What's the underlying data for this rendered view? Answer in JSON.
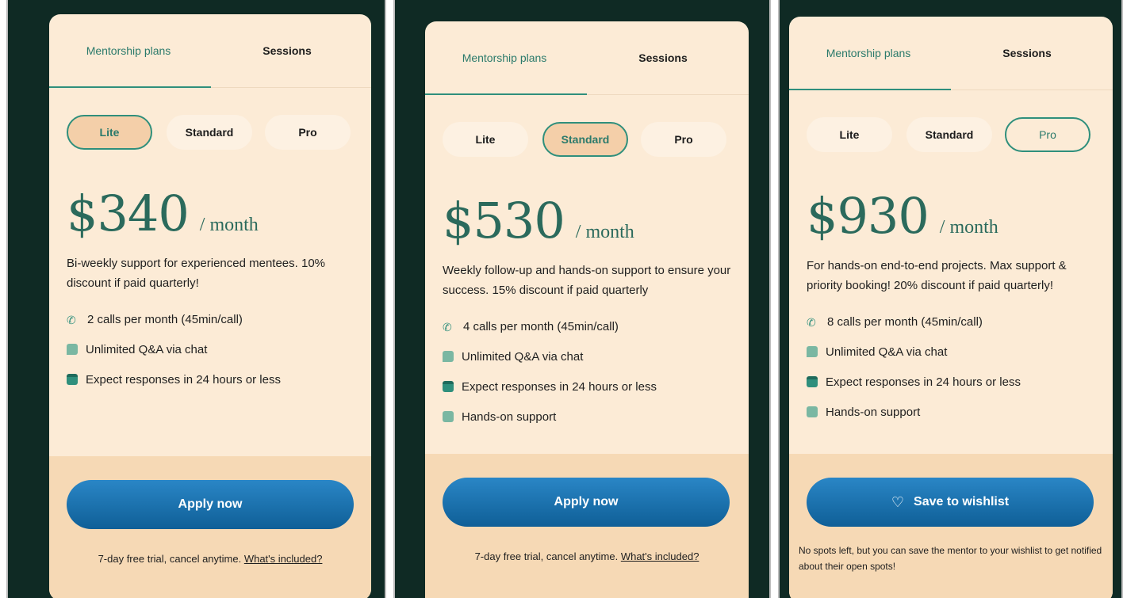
{
  "tabs": {
    "mentorship": "Mentorship plans",
    "sessions": "Sessions"
  },
  "tiers": [
    "Lite",
    "Standard",
    "Pro"
  ],
  "per": "/ month",
  "colors": {
    "accent": "#2f8f7c",
    "card": "#fcebd6",
    "cta": "#1f76b5",
    "bg": "#0f2a24"
  },
  "icons": [
    "phone-icon",
    "chat-icon",
    "calendar-icon",
    "lock-icon",
    "heart-icon"
  ],
  "plans": [
    {
      "selected": "Lite",
      "price": "$340",
      "description": "Bi-weekly support for experienced mentees. 10% discount if paid quarterly!",
      "features": [
        "2 calls per month (45min/call)",
        "Unlimited Q&A via chat",
        "Expect responses in 24 hours or less"
      ],
      "cta": "Apply now",
      "trial": "7-day free trial, cancel anytime.",
      "trial_link": "What's included?"
    },
    {
      "selected": "Standard",
      "price": "$530",
      "description": "Weekly follow-up and hands-on support to ensure your success. 15% discount if paid quarterly",
      "features": [
        "4 calls per month (45min/call)",
        "Unlimited Q&A via chat",
        "Expect responses in 24 hours or less",
        "Hands-on support"
      ],
      "cta": "Apply now",
      "trial": "7-day free trial, cancel anytime.",
      "trial_link": "What's included?"
    },
    {
      "selected": "Pro",
      "price": "$930",
      "description": "For hands-on end-to-end projects. Max support & priority booking! 20% discount if paid quarterly!",
      "features": [
        "8 calls per month (45min/call)",
        "Unlimited Q&A via chat",
        "Expect responses in 24 hours or less",
        "Hands-on support"
      ],
      "cta": "Save to wishlist",
      "note": "No spots left, but you can save the mentor to your wishlist to get notified about their open spots!"
    }
  ]
}
